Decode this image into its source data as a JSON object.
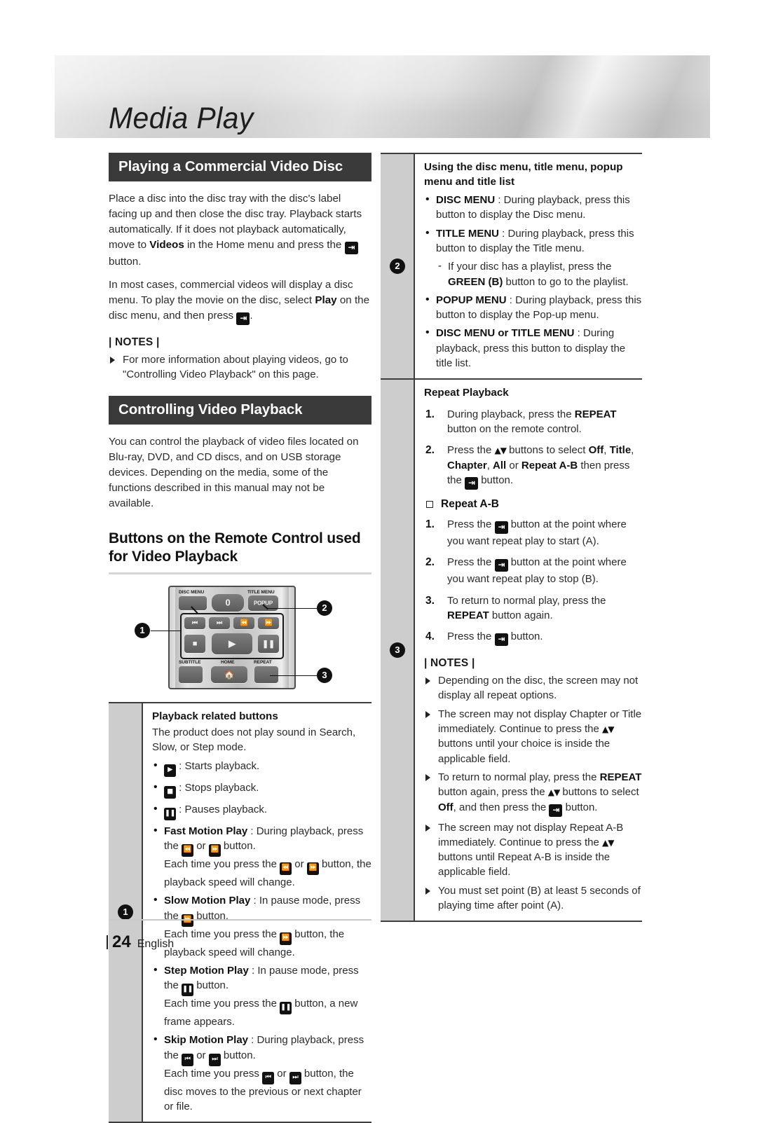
{
  "header": {
    "title": "Media Play"
  },
  "left_column": {
    "section1_bar": "Playing a Commercial Video Disc",
    "section1_p1_a": "Place a disc into the disc tray with the disc's label facing up and then close the disc tray. Playback starts automatically. If it does not playback automatically, move to ",
    "section1_p1_b": "Videos",
    "section1_p1_c": " in the Home menu and press the ",
    "section1_p1_d": " button.",
    "section1_p2_a": "In most cases, commercial videos will display a disc menu. To play the movie on the disc, select ",
    "section1_p2_b": "Play",
    "section1_p2_c": " on the disc menu, and then press ",
    "section1_p2_d": ".",
    "notes_title": "| NOTES |",
    "note1": "For more information about playing videos, go to \"Controlling Video Playback\" on this page.",
    "section2_bar": "Controlling Video Playback",
    "section2_p1": "You can control the playback of video files located on Blu-ray, DVD, and CD discs, and on USB storage devices. Depending on the media, some of the functions described in this manual may not be available.",
    "subhead": "Buttons on the Remote Control used for Video Playback",
    "panel1": {
      "badge": "1",
      "title": "Playback related buttons",
      "intro": "The product does not play sound in Search, Slow, or Step mode.",
      "b1": " : Starts playback.",
      "b2": " : Stops playback.",
      "b3": " : Pauses playback.",
      "b4_bold": "Fast Motion Play",
      "b4_a": " : During playback, press the ",
      "b4_b": " or ",
      "b4_c": " button.",
      "b4_d": "Each time you press the ",
      "b4_e": " or ",
      "b4_f": " button, the playback speed will change.",
      "b5_bold": "Slow Motion Play",
      "b5_a": " : In pause mode, press the ",
      "b5_b": " button.",
      "b5_c": "Each time you press the ",
      "b5_d": " button, the playback speed will change.",
      "b6_bold": "Step Motion Play",
      "b6_a": " : In pause mode, press the ",
      "b6_b": " button.",
      "b6_c": "Each time you press the ",
      "b6_d": " button, a new frame appears.",
      "b7_bold": "Skip Motion Play",
      "b7_a": " : During playback, press the ",
      "b7_b": " or ",
      "b7_c": " button.",
      "b7_d": "Each time you press ",
      "b7_e": " or ",
      "b7_f": " button, the disc moves to the previous or next chapter or file."
    }
  },
  "right_column": {
    "panel2": {
      "badge": "2",
      "title": "Using the disc menu, title menu, popup menu and title list",
      "b1_bold": "DISC MENU",
      "b1_text": " : During playback, press this button to display the Disc menu.",
      "b2_bold": "TITLE MENU",
      "b2_text": " : During playback, press this button to display the Title menu.",
      "d1_a": "If your disc has a playlist, press the ",
      "d1_bold1": "GREEN",
      "d1_b": " ",
      "d1_bold2": "(B)",
      "d1_c": " button to go to the playlist.",
      "b3_bold": "POPUP MENU",
      "b3_text": " : During playback, press this button to display the Pop-up menu.",
      "b4_bold": "DISC MENU or TITLE MENU",
      "b4_text": " : During playback, press this button to display the title list."
    },
    "panel3": {
      "badge": "3",
      "title": "Repeat Playback",
      "n1_num": "1.",
      "n1_a": "During playback, press the ",
      "n1_bold": "REPEAT",
      "n1_b": " button on the remote control.",
      "n2_num": "2.",
      "n2_a": "Press the ",
      "n2_b": " buttons to select ",
      "n2_bold1": "Off",
      "n2_c": ", ",
      "n2_bold2": "Title",
      "n2_d": ", ",
      "n2_bold3": "Chapter",
      "n2_e": ", ",
      "n2_bold4": "All",
      "n2_f": " or ",
      "n2_bold5": "Repeat A-B",
      "n2_g": " then press the ",
      "n2_h": " button.",
      "subitem": "Repeat A-B",
      "r1_num": "1.",
      "r1_a": "Press the ",
      "r1_b": " button at the point where you want repeat play to start (A).",
      "r2_num": "2.",
      "r2_a": "Press the ",
      "r2_b": " button at the point where you want repeat play to stop (B).",
      "r3_num": "3.",
      "r3_a": "To return to normal play, press the ",
      "r3_bold": "REPEAT",
      "r3_b": " button again.",
      "r4_num": "4.",
      "r4_a": "Press the ",
      "r4_b": " button.",
      "notes_title": "| NOTES |",
      "note1": "Depending on the disc, the screen may not display all repeat options.",
      "note2_a": "The screen may not display Chapter or Title immediately. Continue to press the ",
      "note2_b": " buttons until your choice is inside the applicable field.",
      "note3_a": "To return to normal play, press the ",
      "note3_bold1": "REPEAT",
      "note3_b": " button again, press the ",
      "note3_c": " buttons to select ",
      "note3_bold2": "Off",
      "note3_d": ", and then press the ",
      "note3_e": " button.",
      "note4_a": "The screen may not display Repeat A-B immediately. Continue to press the ",
      "note4_b": " buttons until Repeat A-B is inside the applicable field.",
      "note5": "You must set point (B) at least 5 seconds of playing time after point (A)."
    }
  },
  "remote": {
    "label_disc_menu": "DISC MENU",
    "label_title_menu": "TITLE MENU",
    "label_subtitle": "SUBTITLE",
    "label_home": "HOME",
    "label_repeat": "REPEAT",
    "btn_zero": "0",
    "btn_popup": "POPUP",
    "badge1": "1",
    "badge2": "2",
    "badge3": "3"
  },
  "footer": {
    "page_number": "24",
    "language": "English"
  },
  "glyphs": {
    "enter": "↵",
    "play": "▶",
    "stop": "■",
    "pause": "‖",
    "rew": "◀◀",
    "ffwd": "▶▶",
    "prev": "◀◀|",
    "next": "|▶▶",
    "updown": "▲▼"
  }
}
